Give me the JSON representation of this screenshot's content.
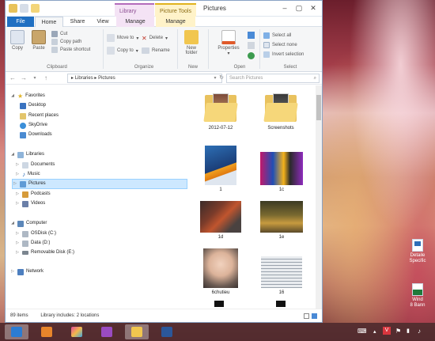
{
  "window": {
    "title": "Pictures",
    "context_tabs": [
      "Library Tools",
      "Picture Tools"
    ]
  },
  "ribbon_tabs": {
    "file": "File",
    "home": "Home",
    "share": "Share",
    "view": "View",
    "manage_library": "Manage",
    "manage_picture": "Manage"
  },
  "ribbon": {
    "clipboard": {
      "copy": "Copy",
      "paste": "Paste",
      "cut": "Cut",
      "copy_path": "Copy path",
      "paste_shortcut": "Paste shortcut",
      "group": "Clipboard"
    },
    "organize": {
      "move_to": "Move to",
      "copy_to": "Copy to",
      "delete": "Delete",
      "rename": "Rename",
      "group": "Organize"
    },
    "new": {
      "new_folder_line1": "New",
      "new_folder_line2": "folder",
      "group": "New"
    },
    "open": {
      "properties": "Properties",
      "group": "Open"
    },
    "select": {
      "select_all": "Select all",
      "select_none": "Select none",
      "invert_selection": "Invert selection",
      "group": "Select"
    }
  },
  "address": {
    "path": [
      "Libraries",
      "Pictures"
    ],
    "search_placeholder": "Search Pictures"
  },
  "nav_pane": {
    "favorites": {
      "label": "Favorites",
      "items": [
        "Desktop",
        "Recent places",
        "SkyDrive",
        "Downloads"
      ]
    },
    "libraries": {
      "label": "Libraries",
      "items": [
        "Documents",
        "Music",
        "Pictures",
        "Podcasts",
        "Videos"
      ]
    },
    "computer": {
      "label": "Computer",
      "items": [
        "OSDisk (C:)",
        "Data (D:)",
        "Removable Disk (E:)"
      ]
    },
    "network": {
      "label": "Network"
    }
  },
  "files": [
    {
      "name": "2012-07-12",
      "kind": "folder"
    },
    {
      "name": "Screenshots",
      "kind": "folder"
    },
    {
      "name": "1",
      "kind": "image"
    },
    {
      "name": "1c",
      "kind": "image"
    },
    {
      "name": "1d",
      "kind": "image"
    },
    {
      "name": "1e",
      "kind": "image"
    },
    {
      "name": "6chutieu",
      "kind": "image"
    },
    {
      "name": "16",
      "kind": "image"
    }
  ],
  "status": {
    "items": "89 items",
    "library": "Library includes: 2 locations"
  },
  "desktop_icons": [
    {
      "line1": "Detaile",
      "line2": "Specific"
    },
    {
      "line1": "Wind",
      "line2": "8 Bann"
    }
  ],
  "colors": {
    "accent": "#1f6fc2",
    "selection": "#cde8ff",
    "library_tools": "#b36cbb",
    "picture_tools": "#e0b31f"
  }
}
